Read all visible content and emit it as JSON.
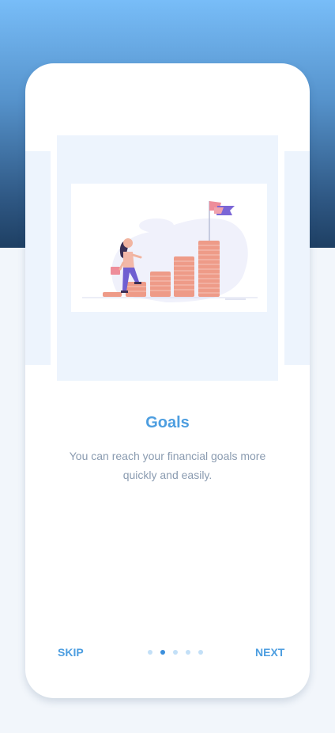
{
  "onboarding": {
    "title": "Goals",
    "description": "You can reach your financial goals more quickly and easily.",
    "illustration_icon": "woman-climbing-coin-stacks-to-flag",
    "skip_label": "SKIP",
    "next_label": "NEXT",
    "pagination": {
      "total": 5,
      "current_index": 1
    }
  },
  "colors": {
    "accent": "#4d9ee0",
    "text_muted": "#8a9bb0",
    "dot_active": "#3c8fdc",
    "dot_inactive": "#c3e0f7",
    "gradient_top": "#78bdf8",
    "gradient_bottom": "#1e3f63",
    "page_bg": "#f2f6fb"
  }
}
